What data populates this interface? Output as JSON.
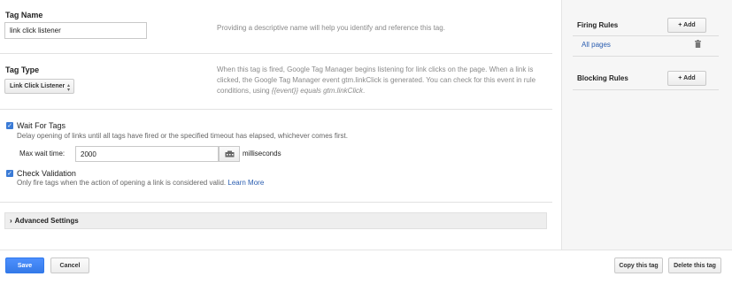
{
  "tag_name": {
    "label": "Tag Name",
    "value": "link click listener",
    "help": "Providing a descriptive name will help you identify and reference this tag."
  },
  "tag_type": {
    "label": "Tag Type",
    "selected": "Link Click Listener",
    "help_part1": "When this tag is fired, Google Tag Manager begins listening for link clicks on the page. When a link is clicked, the Google Tag Manager event gtm.linkClick is generated. You can check for this event in rule conditions, using ",
    "help_em": "{{event}} equals gtm.linkClick",
    "help_end": "."
  },
  "wait_for_tags": {
    "checked": true,
    "title": "Wait For Tags",
    "description": "Delay opening of links until all tags have fired or the specified timeout has elapsed, whichever comes first.",
    "max_wait_label": "Max wait time:",
    "max_wait_value": "2000",
    "unit": "milliseconds"
  },
  "check_validation": {
    "checked": true,
    "title": "Check Validation",
    "description": "Only fire tags when the action of opening a link is considered valid.",
    "learn_more": "Learn More"
  },
  "advanced_settings": {
    "label": "Advanced Settings",
    "chevron": "›"
  },
  "firing_rules": {
    "title": "Firing Rules",
    "add_label": "+ Add",
    "items": [
      "All pages"
    ]
  },
  "blocking_rules": {
    "title": "Blocking Rules",
    "add_label": "+ Add"
  },
  "footer": {
    "save": "Save",
    "cancel": "Cancel",
    "copy": "Copy this tag",
    "delete": "Delete this tag"
  },
  "colors": {
    "primary": "#4d90fe",
    "link": "#2a5db0",
    "checkbox": "#3b7bd6"
  }
}
